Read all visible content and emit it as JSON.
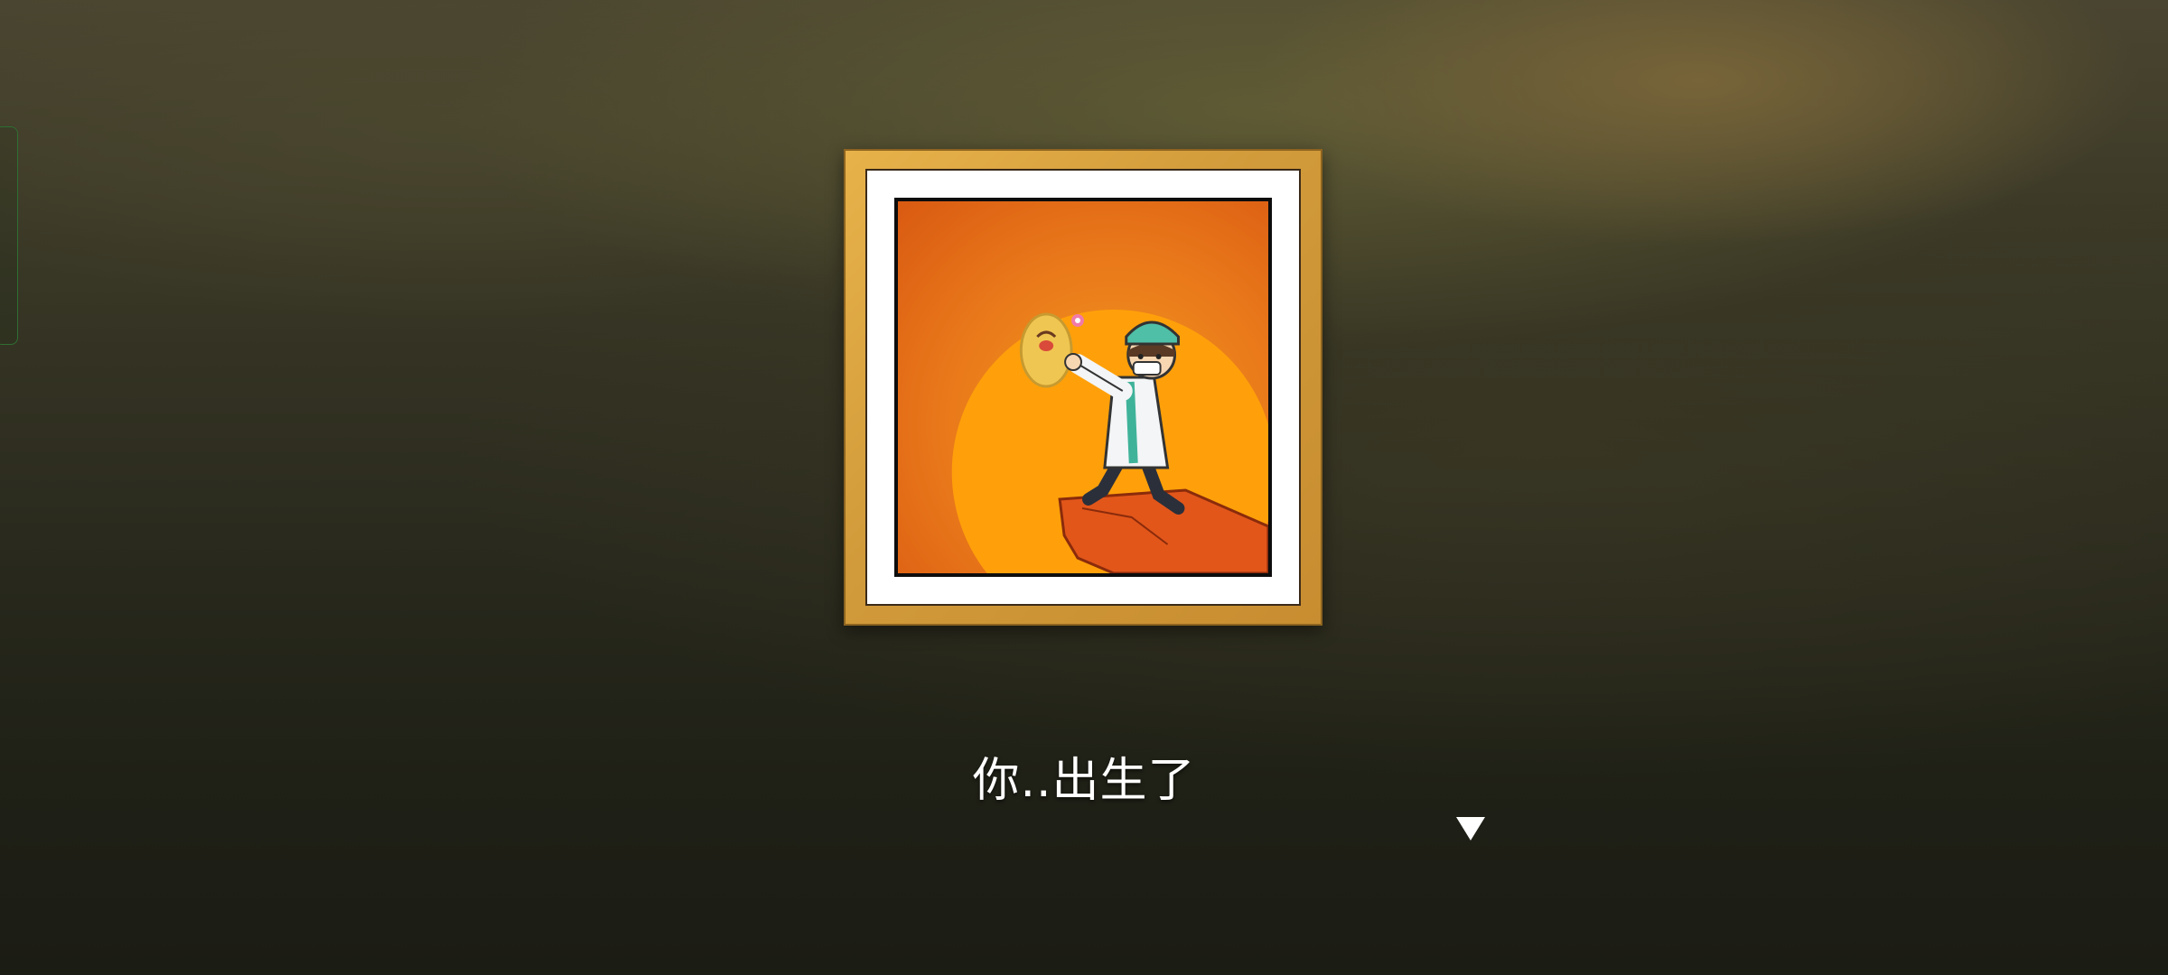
{
  "dialogue": {
    "text": "你..出生了",
    "advance_icon": "triangle-down-icon"
  },
  "picture": {
    "subject": "doctor-lifting-newborn-on-cliff-illustration"
  },
  "colors": {
    "frame_gold": "#d19a3a",
    "sun_orange": "#f39a1d",
    "sky_orange": "#d95a12",
    "text": "#ffffff"
  }
}
